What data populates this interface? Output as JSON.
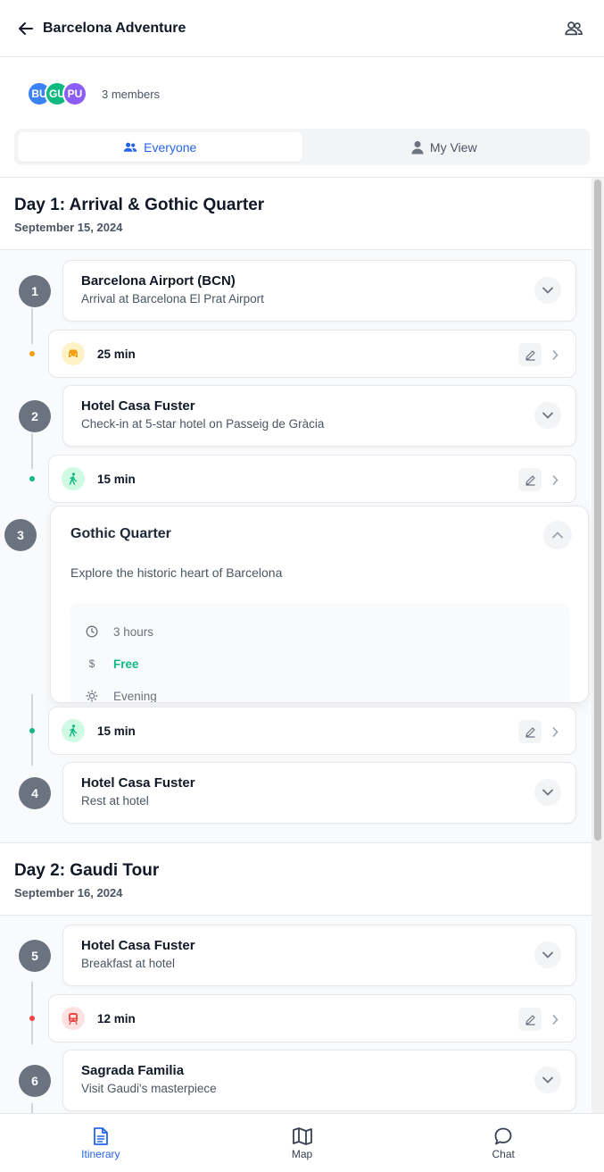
{
  "header": {
    "title": "Barcelona Adventure"
  },
  "members": {
    "avatars": [
      {
        "initials": "BU",
        "color": "#3b82f6"
      },
      {
        "initials": "GU",
        "color": "#10b981"
      },
      {
        "initials": "PU",
        "color": "#8b5cf6"
      }
    ],
    "count_label": "3 members"
  },
  "tabs": [
    {
      "label": "Everyone",
      "active": true
    },
    {
      "label": "My View",
      "active": false
    }
  ],
  "days": [
    {
      "title": "Day 1: Arrival & Gothic Quarter",
      "date": "September 15, 2024"
    },
    {
      "title": "Day 2: Gaudi Tour",
      "date": "September 16, 2024"
    }
  ],
  "stops": [
    {
      "number": "1",
      "name": "Barcelona Airport (BCN)",
      "description": "Arrival at Barcelona El Prat Airport"
    },
    {
      "number": "2",
      "name": "Hotel Casa Fuster",
      "description": "Check-in at 5-star hotel on Passeig de Gràcia"
    },
    {
      "number": "3",
      "name": "Gothic Quarter",
      "description": "Explore the historic heart of Barcelona",
      "expanded": true,
      "details": {
        "duration": "3 hours",
        "price": "Free",
        "time_of_day": "Evening"
      }
    },
    {
      "number": "4",
      "name": "Hotel Casa Fuster",
      "description": "Rest at hotel"
    },
    {
      "number": "5",
      "name": "Hotel Casa Fuster",
      "description": "Breakfast at hotel"
    },
    {
      "number": "6",
      "name": "Sagrada Familia",
      "description": "Visit Gaudi's masterpiece"
    }
  ],
  "travels": [
    {
      "mode": "taxi-icon",
      "time": "25 min",
      "color": "#f59e0b",
      "bg": "#fef3c7"
    },
    {
      "mode": "walk-icon",
      "time": "15 min",
      "color": "#10b981",
      "bg": "#d1fae5"
    },
    {
      "mode": "walk-icon",
      "time": "15 min",
      "color": "#10b981",
      "bg": "#d1fae5"
    },
    {
      "mode": "metro-icon",
      "time": "12 min",
      "color": "#ef4444",
      "bg": "#fee2e2"
    }
  ],
  "nav": [
    {
      "label": "Itinerary",
      "active": true
    },
    {
      "label": "Map",
      "active": false
    },
    {
      "label": "Chat",
      "active": false
    }
  ],
  "colors": {
    "accent": "#2563eb",
    "free": "#10b981",
    "number_badge": "#6b7280"
  }
}
